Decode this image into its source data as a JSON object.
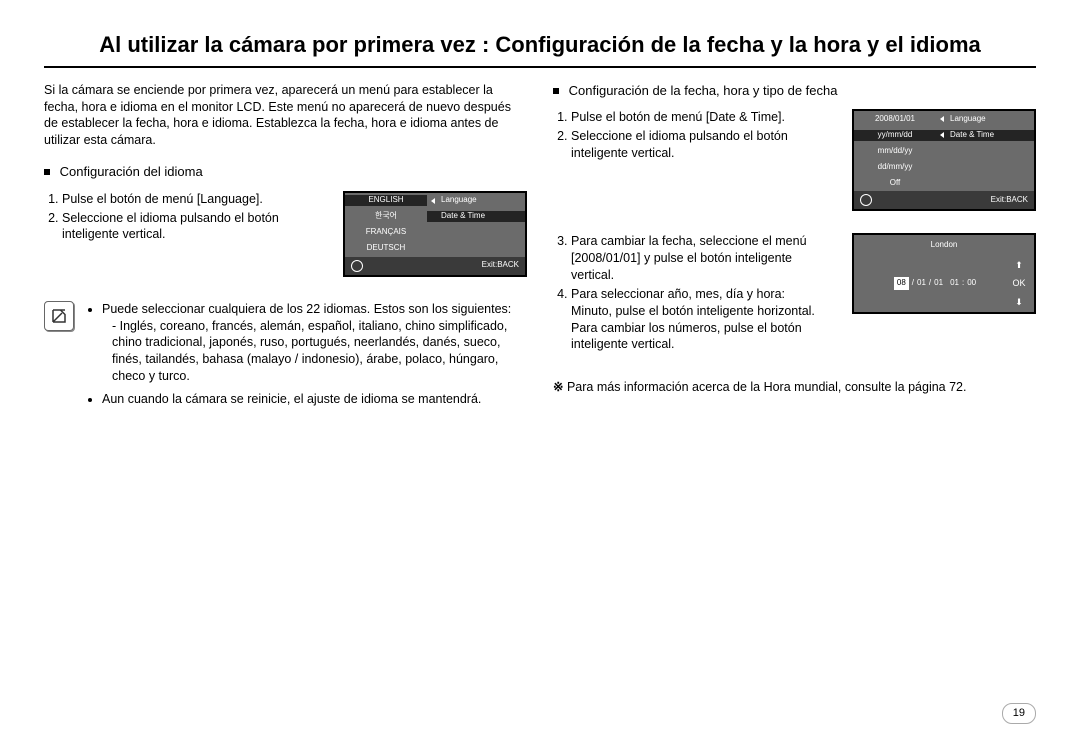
{
  "title": "Al utilizar la cámara por primera vez : Configuración de la fecha y la hora y el idioma",
  "intro": "Si la cámara se enciende por primera vez, aparecerá un menú para establecer la fecha, hora e idioma en el monitor LCD. Este menú no aparecerá de nuevo después de establecer la fecha, hora e idioma. Establezca la fecha, hora e idioma antes de utilizar esta cámara.",
  "left": {
    "heading": "Configuración del idioma",
    "steps": [
      "Pulse el botón de menú [Language].",
      "Seleccione el idioma pulsando el botón inteligente vertical."
    ]
  },
  "lcd1": {
    "left_items": [
      "ENGLISH",
      "한국어",
      "FRANÇAIS",
      "DEUTSCH"
    ],
    "right_items": [
      "Language",
      "Date & Time"
    ],
    "exit": "Exit:BACK"
  },
  "note": {
    "b1": "Puede seleccionar cualquiera de los 22 idiomas. Estos son los siguientes:",
    "langs": "- Inglés, coreano, francés, alemán, español, italiano, chino simplificado, chino tradicional, japonés, ruso, portugués, neerlandés, danés, sueco, finés, tailandés, bahasa (malayo / indonesio), árabe, polaco, húngaro, checo y turco.",
    "b2": "Aun cuando la cámara se reinicie, el ajuste de idioma se mantendrá."
  },
  "right": {
    "heading": "Configuración de la fecha, hora y tipo de fecha",
    "stepsA": [
      "Pulse el botón de menú [Date & Time].",
      "Seleccione el idioma pulsando el botón inteligente vertical."
    ],
    "stepsB": {
      "s3": "Para cambiar la fecha, seleccione el menú [2008/01/01] y pulse el botón inteligente vertical.",
      "s4a": "Para seleccionar año, mes, día y hora:",
      "s4b": "Minuto, pulse el botón inteligente horizontal.",
      "s4c": "Para cambiar los números, pulse el botón inteligente vertical."
    },
    "footnote": "Para más información acerca de la Hora mundial, consulte la página 72."
  },
  "lcd2": {
    "left_items": [
      "2008/01/01",
      "yy/mm/dd",
      "mm/dd/yy",
      "dd/mm/yy",
      "Off"
    ],
    "right_items": [
      "Language",
      "Date & Time"
    ],
    "exit": "Exit:BACK"
  },
  "lcd3": {
    "city": "London",
    "date_parts": [
      "08",
      "/",
      "01",
      "/",
      "01",
      "01",
      ":",
      "00"
    ],
    "ok": "OK"
  },
  "page_number": "19"
}
